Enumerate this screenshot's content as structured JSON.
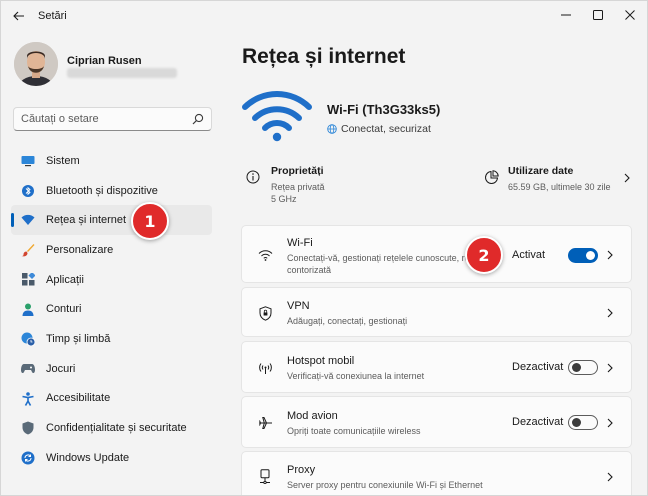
{
  "window": {
    "title": "Setări",
    "back_icon": "arrow-left-icon",
    "controls": [
      "minimize-icon",
      "maximize-icon",
      "close-icon"
    ]
  },
  "user": {
    "name": "Ciprian Rusen",
    "email_blurred": true
  },
  "search": {
    "placeholder": "Căutați o setare",
    "icon": "search-icon"
  },
  "sidebar": {
    "items": [
      {
        "label": "Sistem",
        "icon": "monitor-icon"
      },
      {
        "label": "Bluetooth și dispozitive",
        "icon": "bluetooth-icon"
      },
      {
        "label": "Rețea și internet",
        "icon": "wifi-diamond-icon",
        "active": true
      },
      {
        "label": "Personalizare",
        "icon": "paintbrush-icon"
      },
      {
        "label": "Aplicații",
        "icon": "apps-icon"
      },
      {
        "label": "Conturi",
        "icon": "person-icon"
      },
      {
        "label": "Timp și limbă",
        "icon": "globe-clock-icon"
      },
      {
        "label": "Jocuri",
        "icon": "gamepad-icon"
      },
      {
        "label": "Accesibilitate",
        "icon": "accessibility-icon"
      },
      {
        "label": "Confidențialitate și securitate",
        "icon": "shield-icon"
      },
      {
        "label": "Windows Update",
        "icon": "update-icon"
      }
    ]
  },
  "annotations": [
    "1",
    "2"
  ],
  "main": {
    "title": "Rețea și internet",
    "network": {
      "name": "Wi-Fi (Th3G33ks5)",
      "status": "Conectat, securizat"
    },
    "properties": {
      "title": "Proprietăți",
      "line1": "Rețea privată",
      "line2": "5 GHz"
    },
    "data_usage": {
      "title": "Utilizare date",
      "value": "65.59 GB, ultimele 30 zile"
    },
    "cards": [
      {
        "title": "Wi-Fi",
        "desc": "Conectați-vă, gestionați rețelele cunoscute, rețea contorizată",
        "state": "Activat",
        "toggle_on": true,
        "icon": "wifi-icon"
      },
      {
        "title": "VPN",
        "desc": "Adăugați, conectați, gestionați",
        "icon": "vpn-shield-icon"
      },
      {
        "title": "Hotspot mobil",
        "desc": "Verificați-vă conexiunea la internet",
        "state": "Dezactivat",
        "toggle_on": false,
        "icon": "hotspot-icon"
      },
      {
        "title": "Mod avion",
        "desc": "Opriți toate comunicațiile wireless",
        "state": "Dezactivat",
        "toggle_on": false,
        "icon": "airplane-icon"
      },
      {
        "title": "Proxy",
        "desc": "Server proxy pentru conexiunile Wi-Fi și Ethernet",
        "icon": "proxy-icon"
      }
    ]
  },
  "colors": {
    "accent": "#005fb8",
    "badge": "#e02a2a",
    "background": "#f3f3f3",
    "card": "#fbfbfb"
  }
}
